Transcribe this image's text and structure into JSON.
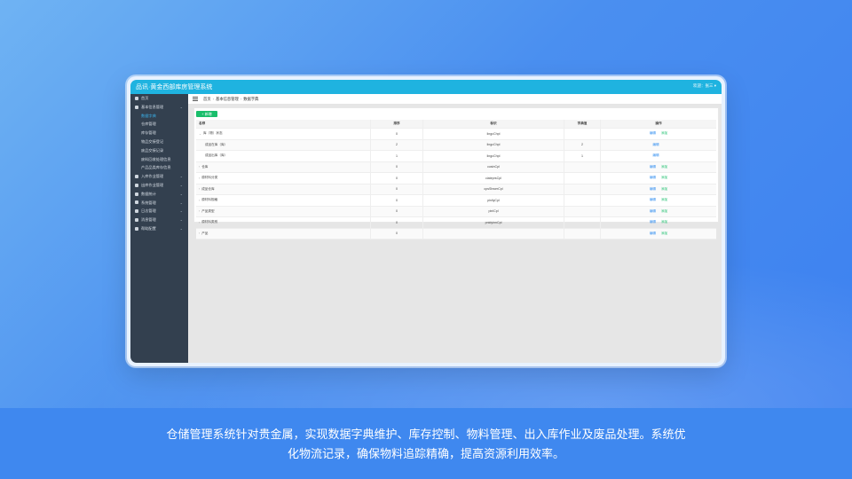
{
  "app": {
    "title": "品讯·黄金西部库房管理系统",
    "user": "欢迎：张三 ▾"
  },
  "sidebar": {
    "items": [
      {
        "label": "首页"
      },
      {
        "label": "基本信息管理",
        "expanded": true,
        "children": [
          {
            "label": "数据字典",
            "active": true
          },
          {
            "label": "仓库管理"
          },
          {
            "label": "库存管理"
          },
          {
            "label": "物品交接登记"
          },
          {
            "label": "废品交接记录"
          },
          {
            "label": "废料回收处理信息"
          },
          {
            "label": "产品品类库存信息"
          }
        ]
      },
      {
        "label": "入库作业管理"
      },
      {
        "label": "出库作业管理"
      },
      {
        "label": "数据统计"
      },
      {
        "label": "系统管理"
      },
      {
        "label": "日志管理"
      },
      {
        "label": "消息管理"
      },
      {
        "label": "帮助配置"
      }
    ]
  },
  "breadcrumb": {
    "home": "首页",
    "level1": "基本信息管理",
    "current": "数据字典"
  },
  "toolbar": {
    "add_label": "+ 新增"
  },
  "table": {
    "headers": [
      "名称",
      "排序",
      "标识",
      "字典值",
      "操作"
    ],
    "rows": [
      {
        "name": "库（物）状态",
        "sort": "0",
        "code": "lingcChpl",
        "value": "",
        "edit": "编辑",
        "add": "添加",
        "caret": "⌄",
        "indent": false
      },
      {
        "name": "成品在库（库）",
        "sort": "2",
        "code": "lingcChpl",
        "value": "2",
        "edit": "编辑",
        "add": "",
        "caret": "",
        "indent": true
      },
      {
        "name": "成品出库（库）",
        "sort": "1",
        "code": "lingcChpl",
        "value": "1",
        "edit": "编辑",
        "add": "",
        "caret": "",
        "indent": true
      },
      {
        "name": "仓库",
        "sort": "0",
        "code": "cusinCpl",
        "value": "",
        "edit": "编辑",
        "add": "添加",
        "caret": "›",
        "indent": false
      },
      {
        "name": "原材料分类",
        "sort": "0",
        "code": "ciateprsCpl",
        "value": "",
        "edit": "编辑",
        "add": "添加",
        "caret": "›",
        "indent": false
      },
      {
        "name": "成品仓库",
        "sort": "0",
        "code": "cpsShwerCpl",
        "value": "",
        "edit": "编辑",
        "add": "添加",
        "caret": "›",
        "indent": false
      },
      {
        "name": "原材料规格",
        "sort": "0",
        "code": "pinllyCpl",
        "value": "",
        "edit": "编辑",
        "add": "添加",
        "caret": "›",
        "indent": false
      },
      {
        "name": "产品类型",
        "sort": "0",
        "code": "pinlCpl",
        "value": "",
        "edit": "编辑",
        "add": "添加",
        "caret": "›",
        "indent": false
      },
      {
        "name": "原材料类别",
        "sort": "0",
        "code": "pnidyinnCpl",
        "value": "",
        "edit": "编辑",
        "add": "添加",
        "caret": "›",
        "indent": false
      },
      {
        "name": "产品",
        "sort": "0",
        "code": "",
        "value": "",
        "edit": "编辑",
        "add": "添加",
        "caret": "›",
        "indent": false
      }
    ]
  },
  "caption": {
    "line1": "仓储管理系统针对贵金属，实现数据字典维护、库存控制、物料管理、出入库作业及废品处理。系统优",
    "line2": "化物流记录，确保物料追踪精确，提高资源利用效率。"
  }
}
